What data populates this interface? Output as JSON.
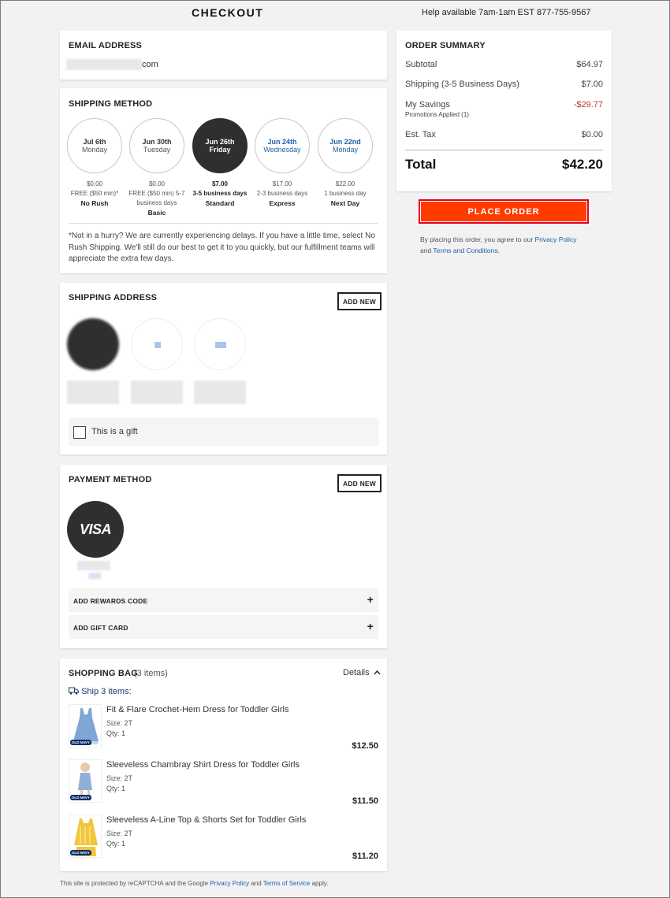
{
  "header": {
    "title": "CHECKOUT",
    "help": "Help available 7am-1am EST",
    "phone": "877-755-9567"
  },
  "email": {
    "title": "EMAIL ADDRESS",
    "value_suffix": "com"
  },
  "shipping_method": {
    "title": "SHIPPING METHOD",
    "options": [
      {
        "date": "Jul 6th",
        "weekday": "Monday",
        "price": "$0.00",
        "desc": "FREE ($50 min)*",
        "name": "No Rush"
      },
      {
        "date": "Jun 30th",
        "weekday": "Tuesday",
        "price": "$0.00",
        "desc": "FREE ($50 min) 5-7 business days",
        "name": "Basic"
      },
      {
        "date": "Jun 26th",
        "weekday": "Friday",
        "price": "$7.00",
        "desc": "3-5 business days",
        "name": "Standard"
      },
      {
        "date": "Jun 24th",
        "weekday": "Wednesday",
        "price": "$17.00",
        "desc": "2-3 business days",
        "name": "Express"
      },
      {
        "date": "Jun 22nd",
        "weekday": "Monday",
        "price": "$22.00",
        "desc": "1 business day",
        "name": "Next Day"
      }
    ],
    "selected_index": 2,
    "note": "*Not in a hurry? We are currently experiencing delays. If you have a little time, select No Rush Shipping. We'll still do our best to get it to you quickly, but our fulfillment teams will appreciate the extra few days."
  },
  "shipping_address": {
    "title": "SHIPPING ADDRESS",
    "add_new": "ADD NEW",
    "gift_label": "This is a gift"
  },
  "payment": {
    "title": "PAYMENT METHOD",
    "add_new": "ADD NEW",
    "card_brand": "VISA",
    "rewards_label": "ADD REWARDS CODE",
    "giftcard_label": "ADD GIFT CARD",
    "plus": "+"
  },
  "bag": {
    "title": "SHOPPING BAG",
    "count": "(3 items)",
    "details": "Details",
    "ship_label": "Ship 3 items:",
    "items": [
      {
        "name": "Fit & Flare Crochet-Hem Dress for Toddler Girls",
        "size": "Size: 2T",
        "qty": "Qty: 1",
        "price": "$12.50"
      },
      {
        "name": "Sleeveless Chambray Shirt Dress for Toddler Girls",
        "size": "Size: 2T",
        "qty": "Qty: 1",
        "price": "$11.50"
      },
      {
        "name": "Sleeveless A-Line Top & Shorts Set for Toddler Girls",
        "size": "Size: 2T",
        "qty": "Qty: 1",
        "price": "$11.20"
      }
    ],
    "brand_badge": "OLD NAVY"
  },
  "summary": {
    "title": "ORDER SUMMARY",
    "subtotal_label": "Subtotal",
    "subtotal": "$64.97",
    "shipping_label": "Shipping (3-5 Business Days)",
    "shipping": "$7.00",
    "savings_label": "My Savings",
    "savings": "-$29.77",
    "promos": "Promotions Applied (1)",
    "tax_label": "Est. Tax",
    "tax": "$0.00",
    "total_label": "Total",
    "total": "$42.20"
  },
  "place_order": "PLACE ORDER",
  "legal": {
    "pre": "By placing this order, you agree to our",
    "privacy": "Privacy Policy",
    "and": "and",
    "terms": "Terms and Conditions",
    "end": "."
  },
  "footer": {
    "pre": "This site is protected by reCAPTCHA and the Google",
    "privacy": "Privacy Policy",
    "and": "and",
    "terms": "Terms of Service",
    "end": "apply."
  },
  "colors": {
    "accent": "#ff3b00",
    "link": "#1f5fa8",
    "savings": "#c0392b",
    "selected": "#2f2f2f"
  }
}
